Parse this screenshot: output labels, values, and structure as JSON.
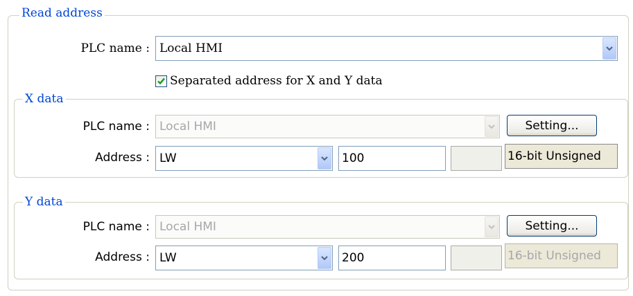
{
  "read_address": {
    "legend": "Read address",
    "plc_name_label": "PLC name :",
    "plc_name_value": "Local HMI",
    "separated_checkbox_label": "Separated address for X and Y data",
    "separated_checked": true
  },
  "x_data": {
    "legend": "X data",
    "plc_name_label": "PLC name :",
    "plc_name_value": "Local HMI",
    "setting_button": "Setting...",
    "address_label": "Address :",
    "device_type": "LW",
    "address_value": "100",
    "data_type": "16-bit Unsigned"
  },
  "y_data": {
    "legend": "Y data",
    "plc_name_label": "PLC name :",
    "plc_name_value": "Local HMI",
    "setting_button": "Setting...",
    "address_label": "Address :",
    "device_type": "LW",
    "address_value": "200",
    "data_type": "16-bit Unsigned"
  },
  "icons": {
    "dropdown": "chevron-down-icon",
    "checkbox": "checkmark-icon"
  },
  "colors": {
    "legend_text": "#0046d5",
    "check_mark": "#21a121",
    "disabled_text": "#a7a6aa"
  }
}
